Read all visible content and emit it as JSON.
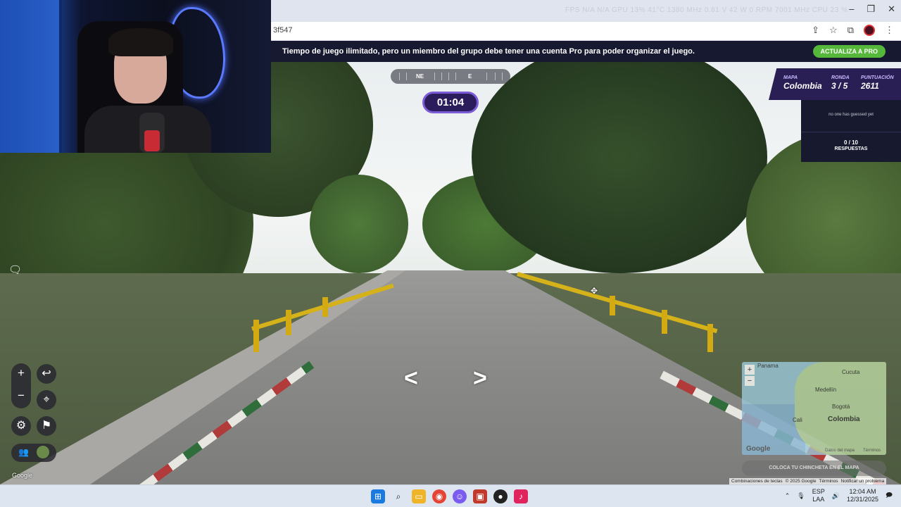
{
  "browser": {
    "stats_text": "FPS N/A N/A   GPU 13% 41°C 1380 MHz 0.81 V 42 W 0 RPM 7001 MHz   CPU 23 %",
    "url_fragment": "3f547",
    "window_controls": {
      "minimize": "–",
      "restore": "❐",
      "close": "✕"
    }
  },
  "banner": {
    "message": "Tiempo de juego ilimitado, pero un miembro del grupo debe tener una cuenta Pro para poder organizar el juego.",
    "upgrade_label": "ACTUALIZA A PRO",
    "upgrade_color": "#55b83a"
  },
  "hud": {
    "compass": {
      "left_mark": "NE",
      "right_mark": "E"
    },
    "timer": "01:04",
    "score": {
      "map_label": "MAPA",
      "map_value": "Colombia",
      "round_label": "RONDA",
      "round_value": "3 / 5",
      "points_label": "PUNTUACIÓN",
      "points_value": "2611"
    },
    "guesses": {
      "status": "no one has guessed yet",
      "count": "0 / 10",
      "label": "RESPUESTAS"
    },
    "nav_arrows": {
      "back": "<",
      "forward": ">"
    }
  },
  "controls": {
    "zoom_in": "+",
    "zoom_out": "−",
    "undo_icon": "↩",
    "pin_icon": "⌖",
    "settings_icon": "⚙",
    "flag_icon": "⚑",
    "chat_icon": "🗨"
  },
  "street_view_watermark": "Google",
  "minimap": {
    "labels": {
      "panama": "Panama",
      "cucuta": "Cucuta",
      "medellin": "Medellín",
      "bogota": "Bogotá",
      "cali": "Cali"
    },
    "country": "Colombia",
    "google": "Google",
    "data_label": "Datos del mapa",
    "terms_label": "Términos",
    "place_button": "COLOCA TU CHINCHETA EN EL MAPA"
  },
  "attribution": [
    "Combinaciones de teclas",
    "© 2025 Google",
    "Términos",
    "Notificar un problema"
  ],
  "taskbar": {
    "language": "ESP",
    "layout": "LAA",
    "time": "12:04 AM",
    "date": "12/31/2025"
  }
}
